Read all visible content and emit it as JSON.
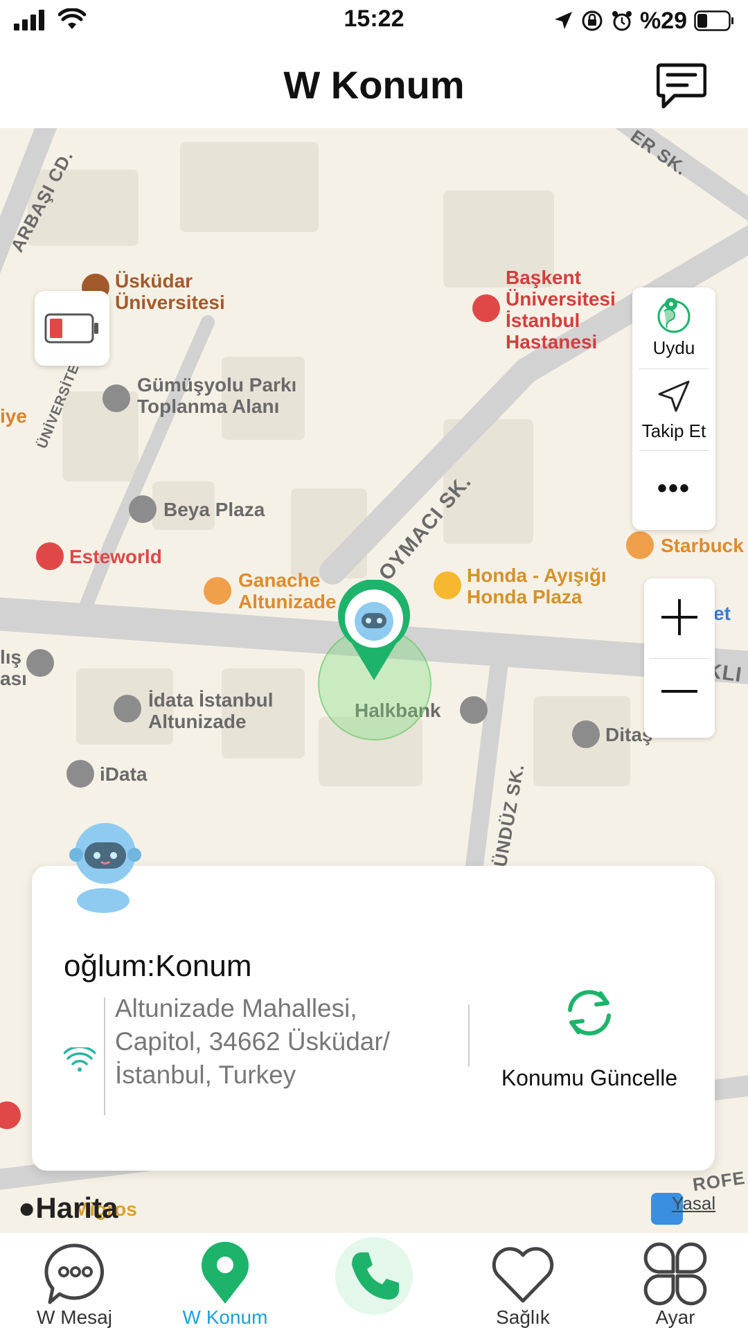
{
  "status": {
    "time": "15:22",
    "battery": "%29"
  },
  "header": {
    "title": "W Konum"
  },
  "map": {
    "streets": [
      "ARBAŞI CD.",
      "ER SK.",
      "ÜNİVERSİTE",
      "OYMACI SK.",
      "KA GÜNDÜZ SK.",
      "KLI",
      "ROFE"
    ],
    "pois": [
      {
        "label": "Üsküdar\nÜniversitesi",
        "color": "#a35a2a"
      },
      {
        "label": "Başkent\nÜniversitesi\nİstanbul\nHastanesi",
        "color": "#d63d3d"
      },
      {
        "label": "Gümüşyolu Parkı\nToplanma Alanı",
        "color": "#6a6a6a"
      },
      {
        "label": "iye",
        "color": "#d9822b"
      },
      {
        "label": "Beya Plaza",
        "color": "#6a6a6a"
      },
      {
        "label": "Esteworld",
        "color": "#e04848"
      },
      {
        "label": "Ganache\nAltunizade",
        "color": "#e08a2a"
      },
      {
        "label": "Honda - Ayışığı\nHonda Plaza",
        "color": "#d4922a"
      },
      {
        "label": "Starbuck",
        "color": "#e08a2a"
      },
      {
        "label": "et",
        "color": "#3a7bd5"
      },
      {
        "label": "İdata İstanbul\nAltunizade",
        "color": "#6a6a6a"
      },
      {
        "label": "Halkbank",
        "color": "#6a6a6a"
      },
      {
        "label": "Ditaş",
        "color": "#6a6a6a"
      },
      {
        "label": "iData",
        "color": "#6a6a6a"
      },
      {
        "label": "lış\nası",
        "color": "#6a6a6a"
      },
      {
        "label": "Migros",
        "color": "#d9a12b"
      }
    ],
    "controls": {
      "satellite": "Uydu",
      "follow": "Takip Et",
      "more": "•••"
    },
    "footer": {
      "maps": "Harita",
      "legal": "Yasal"
    }
  },
  "card": {
    "title": "oğlum:Konum",
    "address": "Altunizade Mahallesi, Capitol, 34662 Üsküdar/ İstanbul, Turkey",
    "refresh": "Konumu Güncelle"
  },
  "tabs": [
    {
      "label": "W Mesaj",
      "active": false
    },
    {
      "label": "W Konum",
      "active": true
    },
    {
      "label": "",
      "active": false
    },
    {
      "label": "Sağlık",
      "active": false
    },
    {
      "label": "Ayar",
      "active": false
    }
  ],
  "colors": {
    "accent": "#1db36b",
    "tab_active": "#1e9fd8",
    "red": "#e04848"
  }
}
